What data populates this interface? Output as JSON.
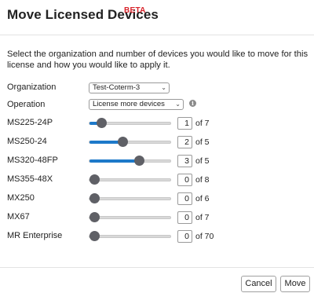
{
  "header": {
    "title": "Move Licensed Devices",
    "badge": "BETA"
  },
  "description": "Select the organization and number of devices you would like to move for this license and how you would like to apply it.",
  "form": {
    "organization": {
      "label": "Organization",
      "value": "Test-Coterm-3"
    },
    "operation": {
      "label": "Operation",
      "value": "License more devices"
    }
  },
  "devices": [
    {
      "name": "MS225-24P",
      "count": "1",
      "of_text": "of 7",
      "level": 0.14
    },
    {
      "name": "MS250-24",
      "count": "2",
      "of_text": "of 5",
      "level": 0.4
    },
    {
      "name": "MS320-48FP",
      "count": "3",
      "of_text": "of 5",
      "level": 0.6
    },
    {
      "name": "MS355-48X",
      "count": "0",
      "of_text": "of 8",
      "level": 0
    },
    {
      "name": "MX250",
      "count": "0",
      "of_text": "of 6",
      "level": 0
    },
    {
      "name": "MX67",
      "count": "0",
      "of_text": "of 7",
      "level": 0
    },
    {
      "name": "MR Enterprise",
      "count": "0",
      "of_text": "of 70",
      "level": 0
    }
  ],
  "footer": {
    "cancel_label": "Cancel",
    "move_label": "Move"
  },
  "colors": {
    "accent": "#1d79c9",
    "beta": "#d8232a",
    "thumb": "#5f6066"
  }
}
